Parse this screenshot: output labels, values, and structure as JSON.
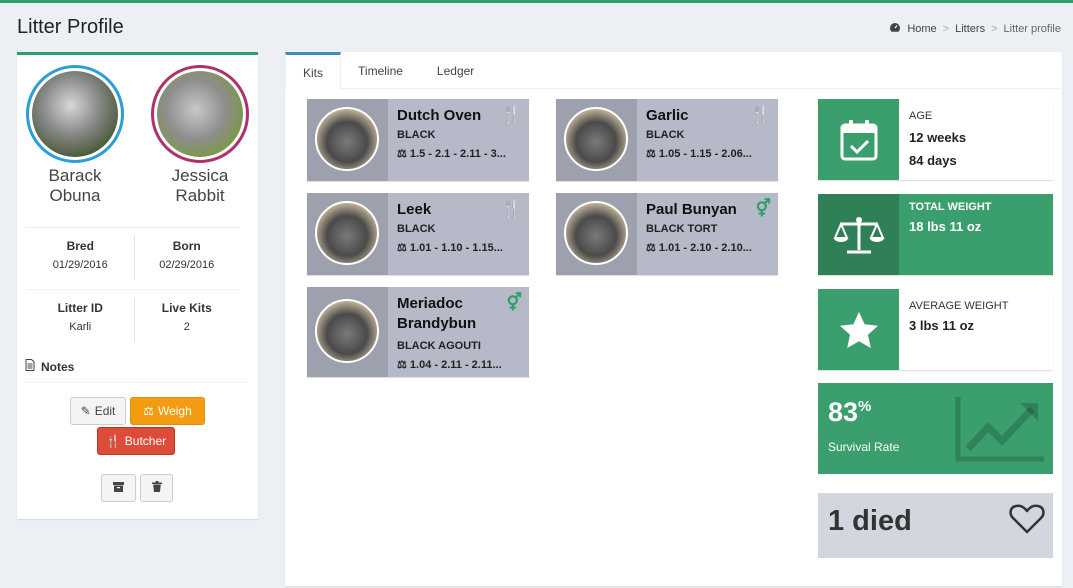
{
  "header": {
    "title": "Litter Profile",
    "breadcrumb": [
      "Home",
      "Litters",
      "Litter profile"
    ]
  },
  "left_panel": {
    "sire": {
      "first": "Barack",
      "last": "Obuna"
    },
    "dam": {
      "first": "Jessica",
      "last": "Rabbit"
    },
    "bred": {
      "label": "Bred",
      "value": "01/29/2016"
    },
    "born": {
      "label": "Born",
      "value": "02/29/2016"
    },
    "litter_id": {
      "label": "Litter ID",
      "value": "Karli"
    },
    "live_kits": {
      "label": "Live Kits",
      "value": "2"
    },
    "notes_label": "Notes",
    "buttons": {
      "edit": "Edit",
      "weigh": "Weigh",
      "butcher": "Butcher"
    }
  },
  "tabs": [
    "Kits",
    "Timeline",
    "Ledger"
  ],
  "kits": [
    {
      "name": "Dutch Oven",
      "color": "BLACK",
      "weights": "1.5 - 2.1 - 2.11 - 3...",
      "status": "butchered"
    },
    {
      "name": "Garlic",
      "color": "BLACK",
      "weights": "1.05 - 1.15 - 2.06...",
      "status": "butchered"
    },
    {
      "name": "Leek",
      "color": "BLACK",
      "weights": "1.01 - 1.10 - 1.15...",
      "status": "butchered"
    },
    {
      "name": "Paul Bunyan",
      "color": "BLACK TORT",
      "weights": "1.01 - 2.10 - 2.10...",
      "status": "alive"
    },
    {
      "name": "Meriadoc Brandybun",
      "color": "BLACK AGOUTI",
      "weights": "1.04 - 2.11 - 2.11...",
      "status": "alive"
    }
  ],
  "stats": {
    "age": {
      "label": "AGE",
      "weeks": "12 weeks",
      "days": "84 days"
    },
    "total_weight": {
      "label": "TOTAL WEIGHT",
      "value": "18 lbs 11 oz"
    },
    "average_weight": {
      "label": "AVERAGE WEIGHT",
      "value": "3 lbs 11 oz"
    },
    "survival": {
      "value": "83",
      "unit": "%",
      "label": "Survival Rate"
    },
    "died": {
      "text": "1 died"
    }
  },
  "colors": {
    "accent": "#3b9f6d",
    "butcher": "#dd4b39",
    "weigh": "#f39c12",
    "kit_bg": "#b5b9c8"
  }
}
